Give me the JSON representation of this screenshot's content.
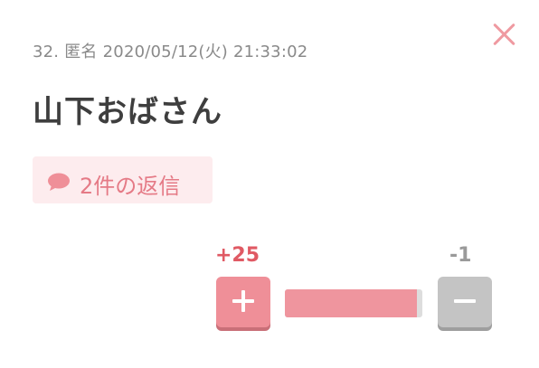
{
  "comment": {
    "number": "32.",
    "author": "匿名",
    "datetime": "2020/05/12(火) 21:33:02",
    "body": "山下おばさん",
    "reply_label": "2件の返信"
  },
  "votes": {
    "plus_label": "+25",
    "minus_label": "-1",
    "plus": 25,
    "minus": 1
  },
  "colors": {
    "accent": "#ef8f98",
    "accent_text": "#e05a64",
    "reply_bg": "#fdecee",
    "neutral": "#c4c4c4"
  },
  "icons": {
    "close": "close-icon",
    "reply": "speech-bubble-icon",
    "plus": "plus-icon",
    "minus": "minus-icon"
  }
}
